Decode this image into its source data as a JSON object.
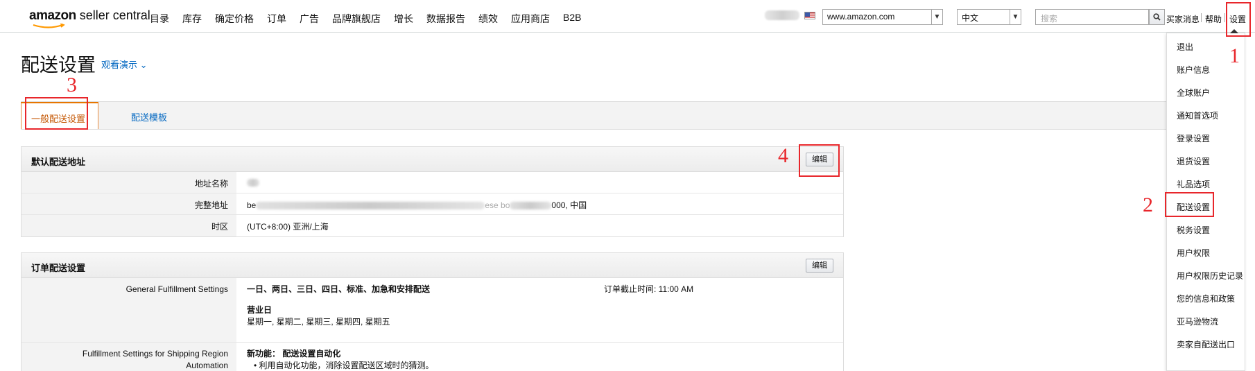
{
  "logo": {
    "brand": "amazon",
    "rest": " seller central"
  },
  "nav": [
    "目录",
    "库存",
    "确定价格",
    "订单",
    "广告",
    "品牌旗舰店",
    "增长",
    "数据报告",
    "绩效",
    "应用商店",
    "B2B"
  ],
  "header": {
    "marketplace": "www.amazon.com",
    "language": "中文",
    "search_placeholder": "搜索",
    "buyer_messages": "买家消息",
    "help": "帮助",
    "settings": "设置"
  },
  "page": {
    "title": "配送设置",
    "demo_link": "观看演示 ⌄"
  },
  "tabs": [
    "一般配送设置",
    "配送模板"
  ],
  "default_address": {
    "title": "默认配送地址",
    "edit_label": "编辑",
    "rows": [
      {
        "label": "地址名称",
        "value": ""
      },
      {
        "label": "完整地址",
        "value_prefix": "be",
        "value_mid": "ese bo",
        "value_suffix": "000, 中国"
      },
      {
        "label": "时区",
        "value": "(UTC+8:00) 亚洲/上海"
      }
    ]
  },
  "order_settings": {
    "title": "订单配送设置",
    "edit_label": "编辑",
    "general_label": "General Fulfillment Settings",
    "general_methods": "一日、两日、三日、四日、标准、加急和安排配送",
    "cutoff": "订单截止时间: 11:00 AM",
    "business_days_title": "营业日",
    "business_days": "星期一, 星期二, 星期三, 星期四, 星期五",
    "region_label_1": "Fulfillment Settings for Shipping Region",
    "region_label_2": "Automation",
    "new_feature": "新功能： 配送设置自动化",
    "bullet": "• 利用自动化功能，消除设置配送区域时的猜测。"
  },
  "dropdown": [
    "退出",
    "账户信息",
    "全球账户",
    "通知首选项",
    "登录设置",
    "退货设置",
    "礼品选项",
    "配送设置",
    "税务设置",
    "用户权限",
    "用户权限历史记录",
    "您的信息和政策",
    "亚马逊物流",
    "卖家自配送出口"
  ],
  "annotations": [
    "1",
    "2",
    "3",
    "4"
  ],
  "colors": {
    "accent_orange": "#e77600",
    "link_blue": "#0066c0",
    "annotation_red": "#e8262b"
  }
}
